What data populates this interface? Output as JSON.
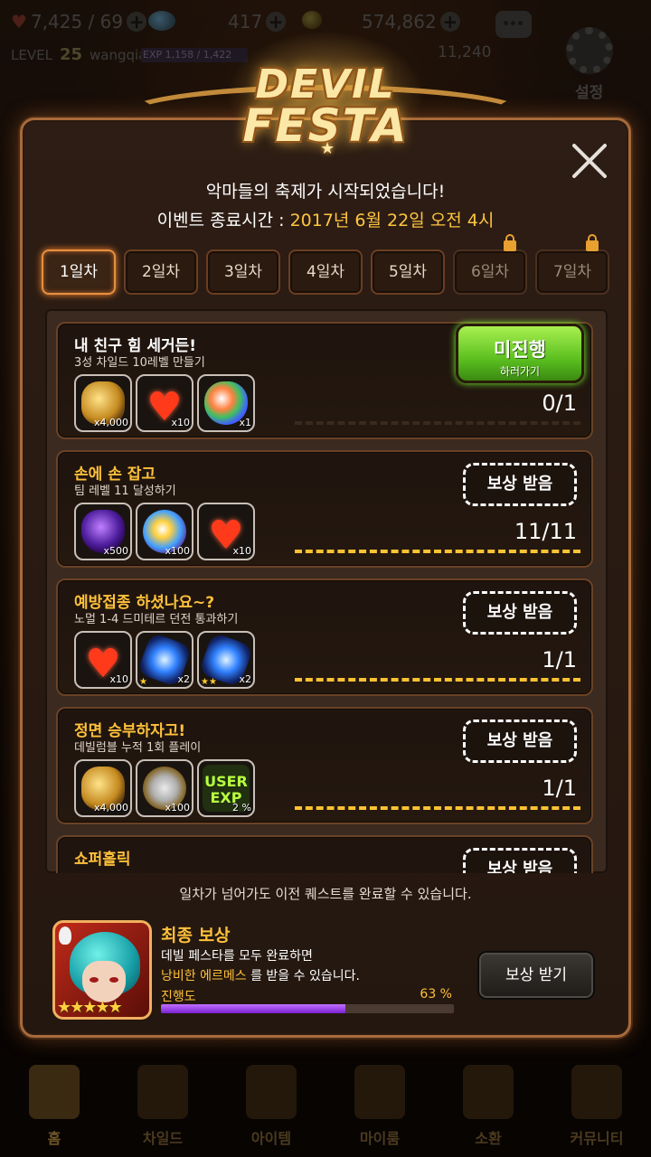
{
  "hud": {
    "hearts": "7,425 / 69",
    "gems": "417",
    "gold": "574,862",
    "level_label": "LEVEL",
    "level": "25",
    "username": "wangqiao",
    "exp": "EXP 1,158 / 1,422",
    "secondary_count": "11,240",
    "settings_label": "설정"
  },
  "logo": {
    "line1": "DEVIL",
    "line2": "FESTA"
  },
  "header": {
    "subtitle": "악마들의 축제가 시작되었습니다!",
    "time_label": "이벤트 종료시간 : ",
    "time_value": "2017년 6월 22일 오전 4시"
  },
  "tabs": [
    {
      "label": "1일차",
      "active": true,
      "locked": false
    },
    {
      "label": "2일차",
      "active": false,
      "locked": false
    },
    {
      "label": "3일차",
      "active": false,
      "locked": false
    },
    {
      "label": "4일차",
      "active": false,
      "locked": false
    },
    {
      "label": "5일차",
      "active": false,
      "locked": false
    },
    {
      "label": "6일차",
      "active": false,
      "locked": true
    },
    {
      "label": "7일차",
      "active": false,
      "locked": true
    }
  ],
  "quests": [
    {
      "title": "내 친구 힘 세거든!",
      "desc": "3성 차일드 10레벨 만들기",
      "rewards": [
        {
          "icon": "gold-coins-icon",
          "count": "x4,000"
        },
        {
          "icon": "heart-icon",
          "count": "x10"
        },
        {
          "icon": "rainbow-potion-icon",
          "count": "x1"
        }
      ],
      "progress": "0/1",
      "button_main": "미진행",
      "button_sub": "하러가기"
    },
    {
      "title": "손에 손 잡고",
      "desc": "팀 레벨 11 달성하기",
      "rewards": [
        {
          "icon": "dark-gem-icon",
          "count": "x500"
        },
        {
          "icon": "rainbow-orb-icon",
          "count": "x100"
        },
        {
          "icon": "heart-icon",
          "count": "x10"
        }
      ],
      "progress": "11/11",
      "button": "보상 받음"
    },
    {
      "title": "예방접종 하셨나요~?",
      "desc": "노멀 1-4 드미테르 던전 통과하기",
      "rewards": [
        {
          "icon": "heart-icon",
          "count": "x10"
        },
        {
          "icon": "blue-crystal-icon",
          "count": "x2",
          "stars": "★"
        },
        {
          "icon": "blue-crystal-icon",
          "count": "x2",
          "stars": "★★"
        }
      ],
      "progress": "1/1",
      "button": "보상 받음"
    },
    {
      "title": "정면 승부하자고!",
      "desc": "데빌럼블 누적 1회 플레이",
      "rewards": [
        {
          "icon": "gold-coins-icon",
          "count": "x4,000"
        },
        {
          "icon": "silver-medal-icon",
          "count": "x100"
        },
        {
          "icon": "user-exp-icon",
          "count": "2 %",
          "label": "USER EXP"
        }
      ],
      "progress": "1/1",
      "button": "보상 받음"
    },
    {
      "title": "쇼퍼홀릭",
      "desc": "",
      "button": "보상 받음"
    }
  ],
  "notice": "일차가 넘어가도 이전 퀘스트를 완료할 수 있습니다.",
  "final_reward": {
    "title": "최종 보상",
    "line1": "데빌 페스타를 모두 완료하면",
    "highlight": "낭비한 에르메스",
    "line2_rest": " 를 받을 수 있습니다.",
    "progress_label": "진행도",
    "progress_text": "63 %",
    "progress_value": 0.63,
    "stars": "★★★★★",
    "button": "보상 받기"
  },
  "nav": [
    {
      "label": "홈",
      "icon": "home-icon"
    },
    {
      "label": "차일드",
      "icon": "child-icon"
    },
    {
      "label": "아이템",
      "icon": "item-icon"
    },
    {
      "label": "마이룸",
      "icon": "myroom-icon"
    },
    {
      "label": "소환",
      "icon": "summon-icon"
    },
    {
      "label": "커뮤니티",
      "icon": "community-icon"
    }
  ],
  "colors": {
    "accent": "#ffc13a",
    "go_button": "#5cc020",
    "progress_fill": "#9a40e8"
  }
}
